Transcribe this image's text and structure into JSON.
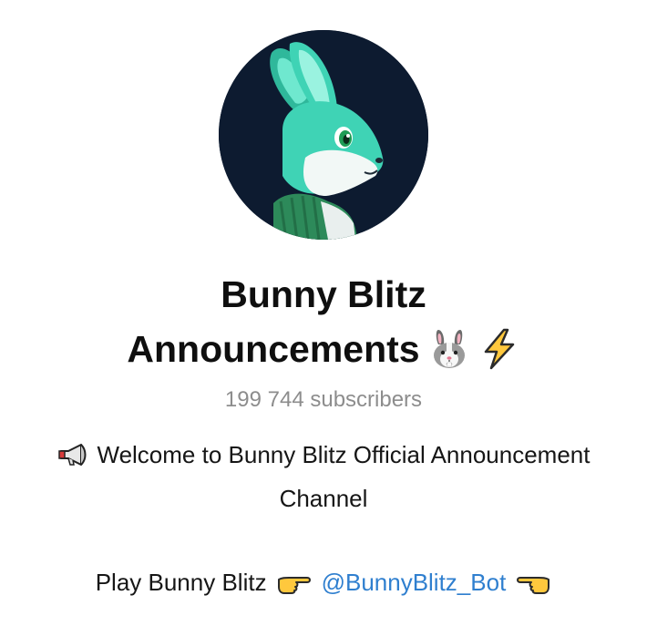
{
  "channel": {
    "title_line1": "Bunny Blitz",
    "title_line2": "Announcements",
    "subscribers": "199 744 subscribers",
    "description_line1": "Welcome to Bunny Blitz Official Announcement",
    "description_line2": "Channel",
    "play_text": "Play Bunny Blitz",
    "bot_link": "@BunnyBlitz_Bot"
  },
  "icons": {
    "title_icons": [
      "rabbit-face-icon",
      "lightning-icon"
    ],
    "desc_icon": "megaphone-icon",
    "pointing_right": "pointing-right-icon",
    "pointing_left": "pointing-left-icon"
  },
  "colors": {
    "title": "#0f0f0f",
    "subtitle": "#8d8d8d",
    "link": "#2f7fcf",
    "avatar_bg": "#0d1b30",
    "bunny_teal": "#3fd3b5"
  }
}
